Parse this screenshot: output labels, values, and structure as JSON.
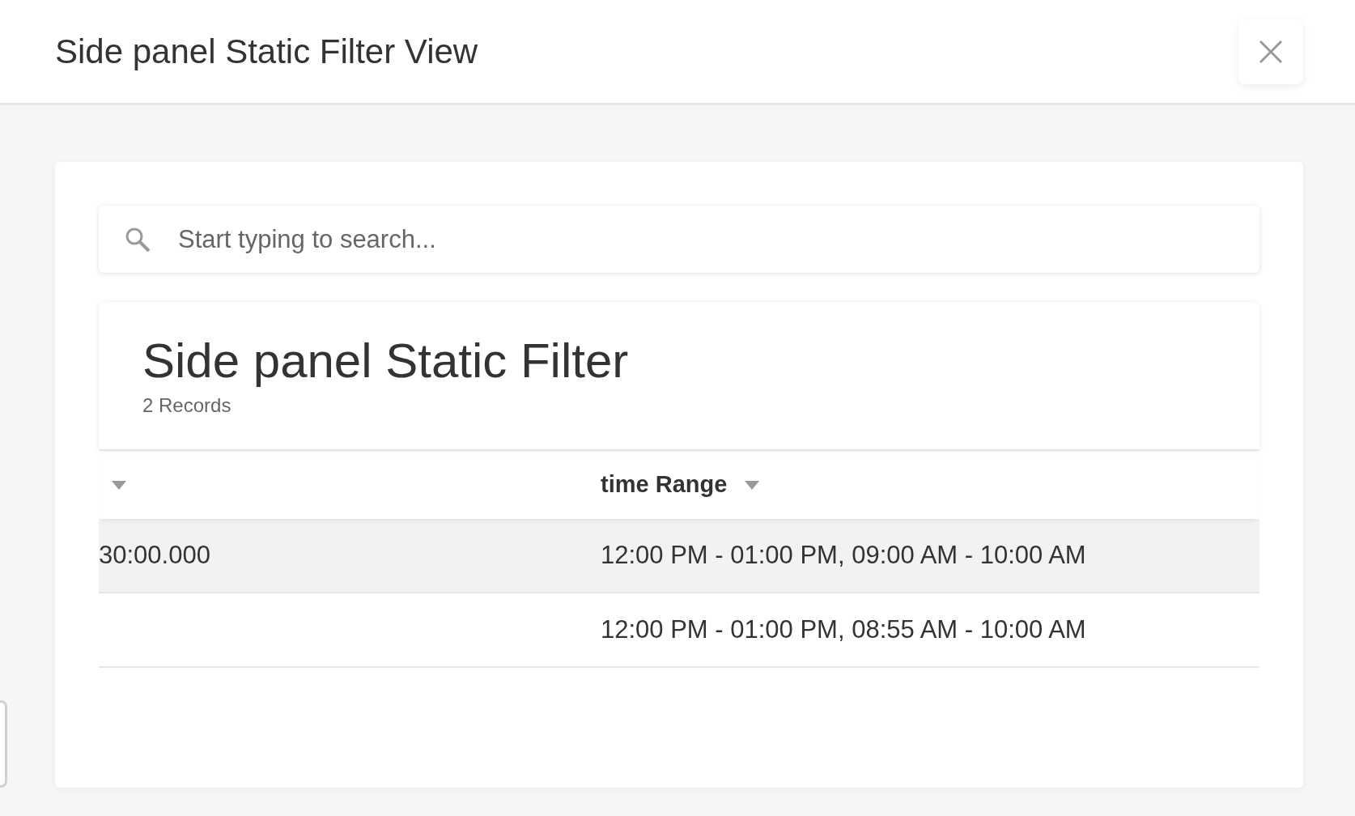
{
  "window": {
    "title": "Side panel Static Filter View"
  },
  "search": {
    "placeholder": "Start typing to search..."
  },
  "report": {
    "title": "Side panel Static Filter",
    "count": "2 Records"
  },
  "table": {
    "columns": [
      {},
      {
        "label": "time Range"
      }
    ],
    "rows": [
      {
        "cells": [
          "30:00.000",
          "12:00 PM - 01:00 PM, 09:00 AM - 10:00 AM"
        ],
        "selected": true
      },
      {
        "cells": [
          "",
          "12:00 PM - 01:00 PM, 08:55 AM - 10:00 AM"
        ],
        "selected": false
      }
    ]
  }
}
